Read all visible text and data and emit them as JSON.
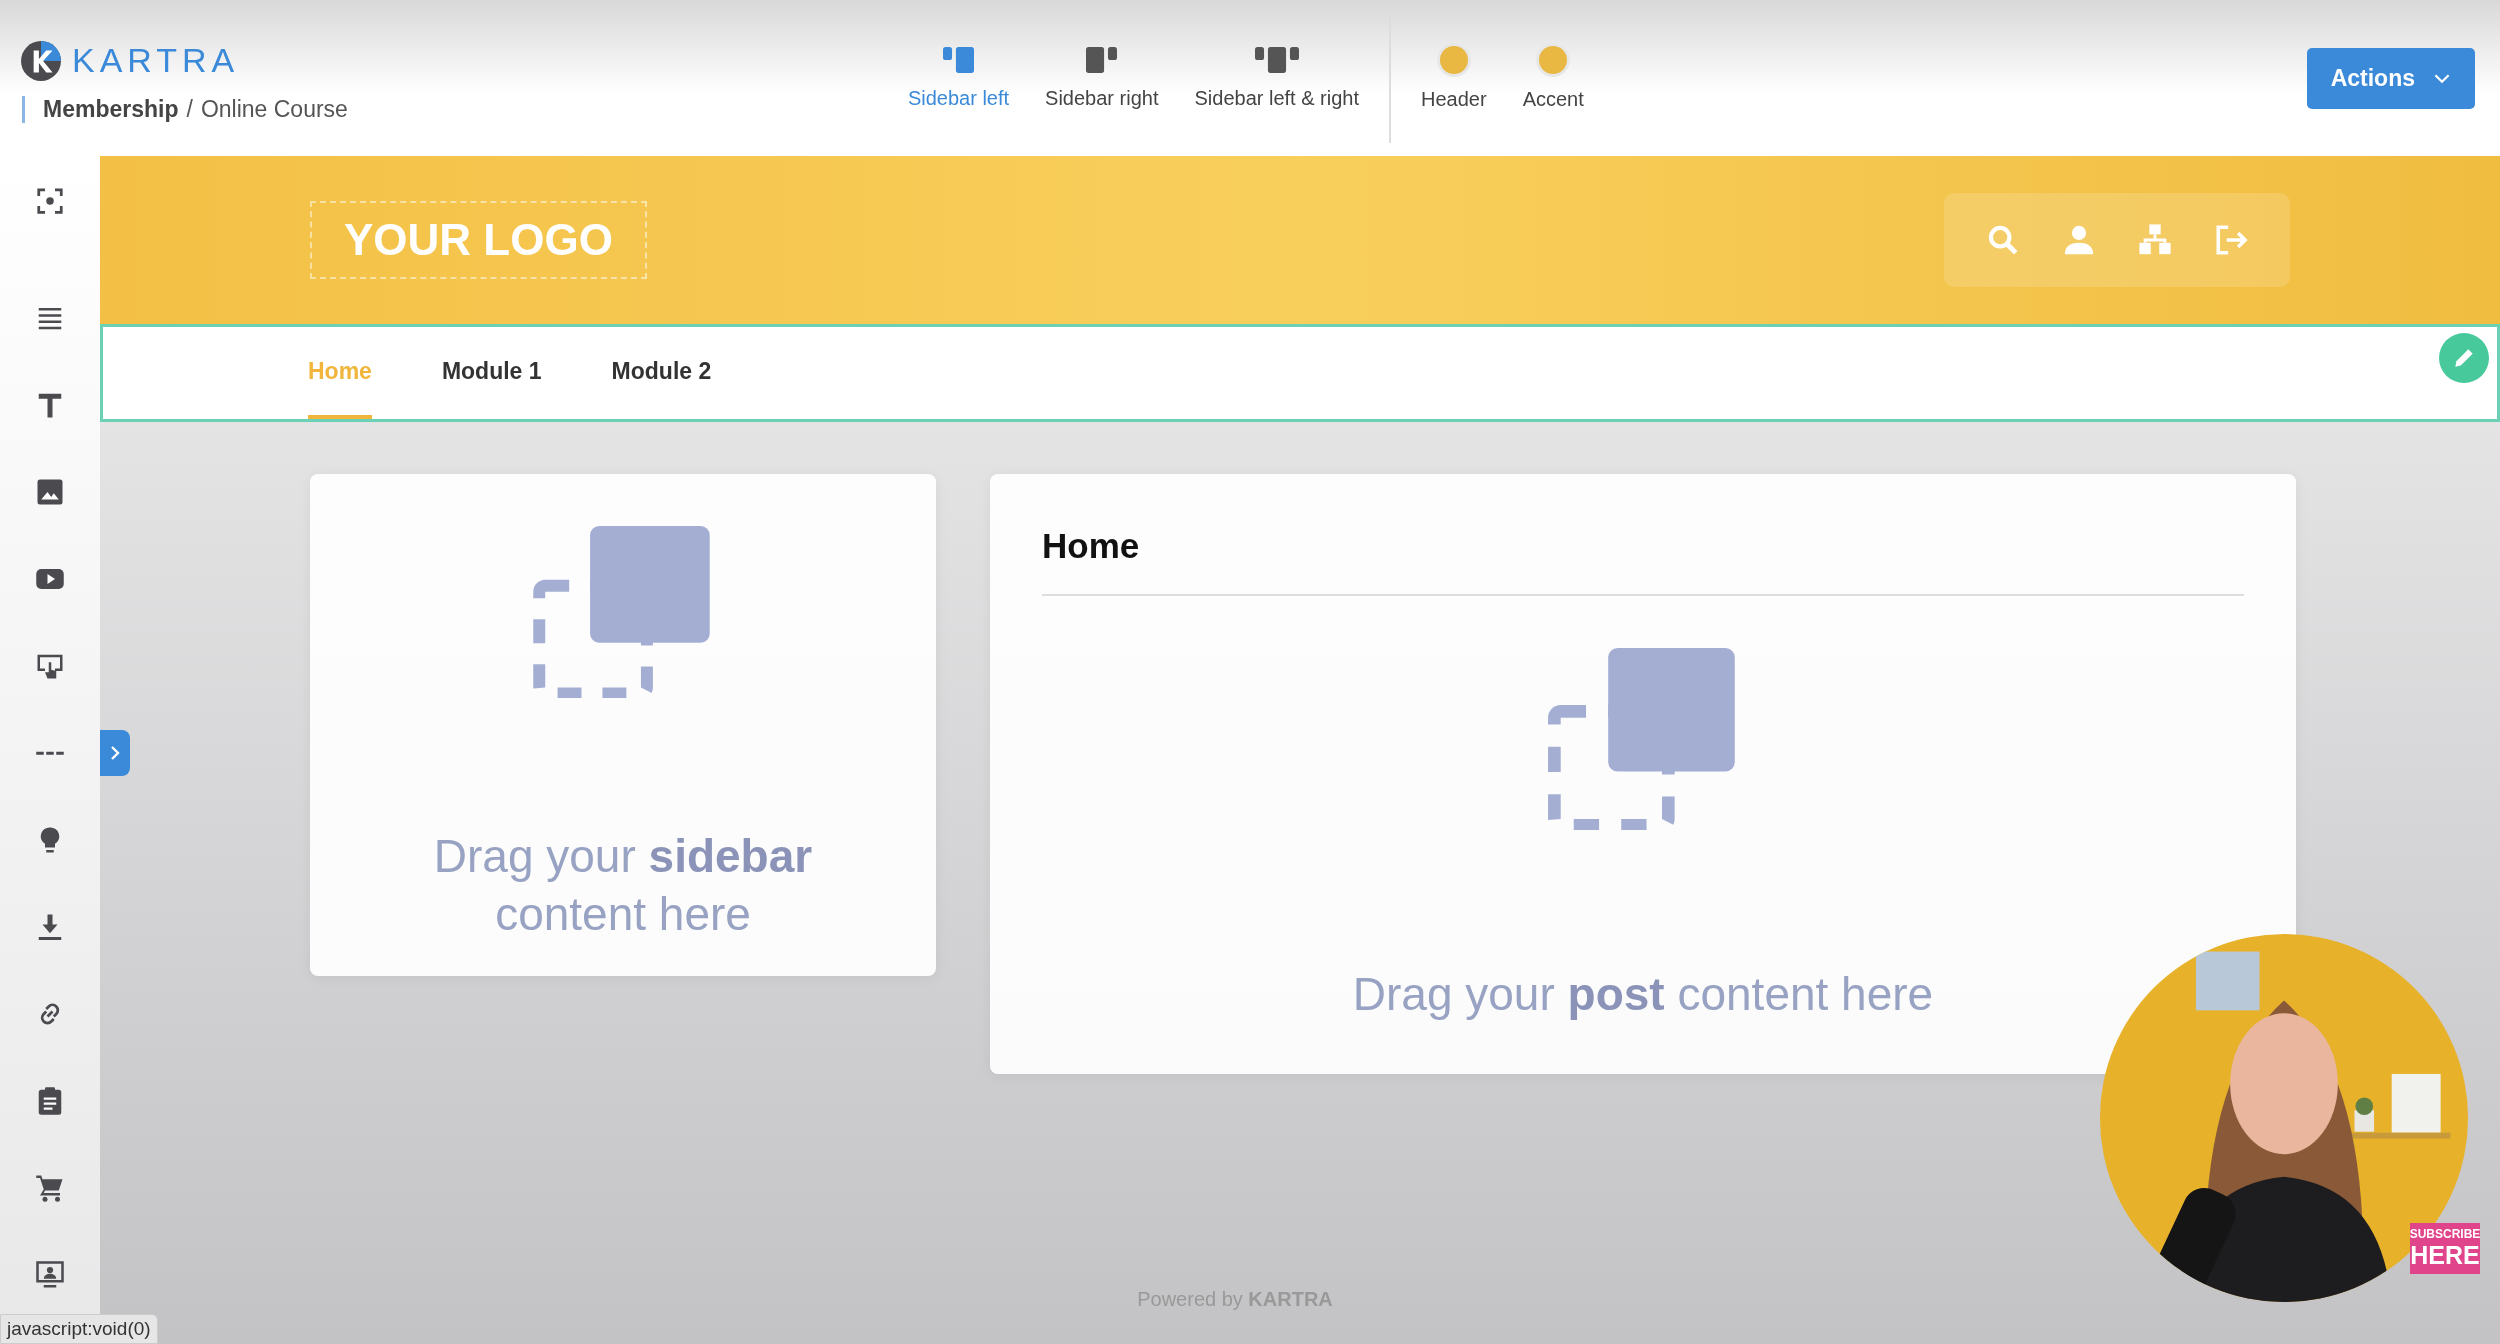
{
  "app": {
    "logo": "KARTRA",
    "breadcrumb": {
      "parent": "Membership",
      "separator": "/",
      "current": "Online Course"
    }
  },
  "layout_options": [
    {
      "label": "Sidebar left",
      "kind": "left",
      "selected": true
    },
    {
      "label": "Sidebar right",
      "kind": "right",
      "selected": false
    },
    {
      "label": "Sidebar left & right",
      "kind": "both",
      "selected": false
    }
  ],
  "color_options": [
    {
      "label": "Header"
    },
    {
      "label": "Accent"
    }
  ],
  "actions_button": "Actions",
  "page": {
    "logo": "YOUR LOGO",
    "nav": [
      {
        "label": "Home",
        "selected": true
      },
      {
        "label": "Module 1",
        "selected": false
      },
      {
        "label": "Module 2",
        "selected": false
      }
    ],
    "sidebar_placeholder": "Drag your **sidebar** content here",
    "post": {
      "title": "Home",
      "placeholder": "Drag your **post** content here"
    },
    "footer": "Powered by **KARTRA**"
  },
  "video_overlay": {
    "kind": "picture",
    "badge": [
      "SUBSCRIBE",
      "HERE"
    ]
  },
  "status_bar": "javascript:void(0)"
}
